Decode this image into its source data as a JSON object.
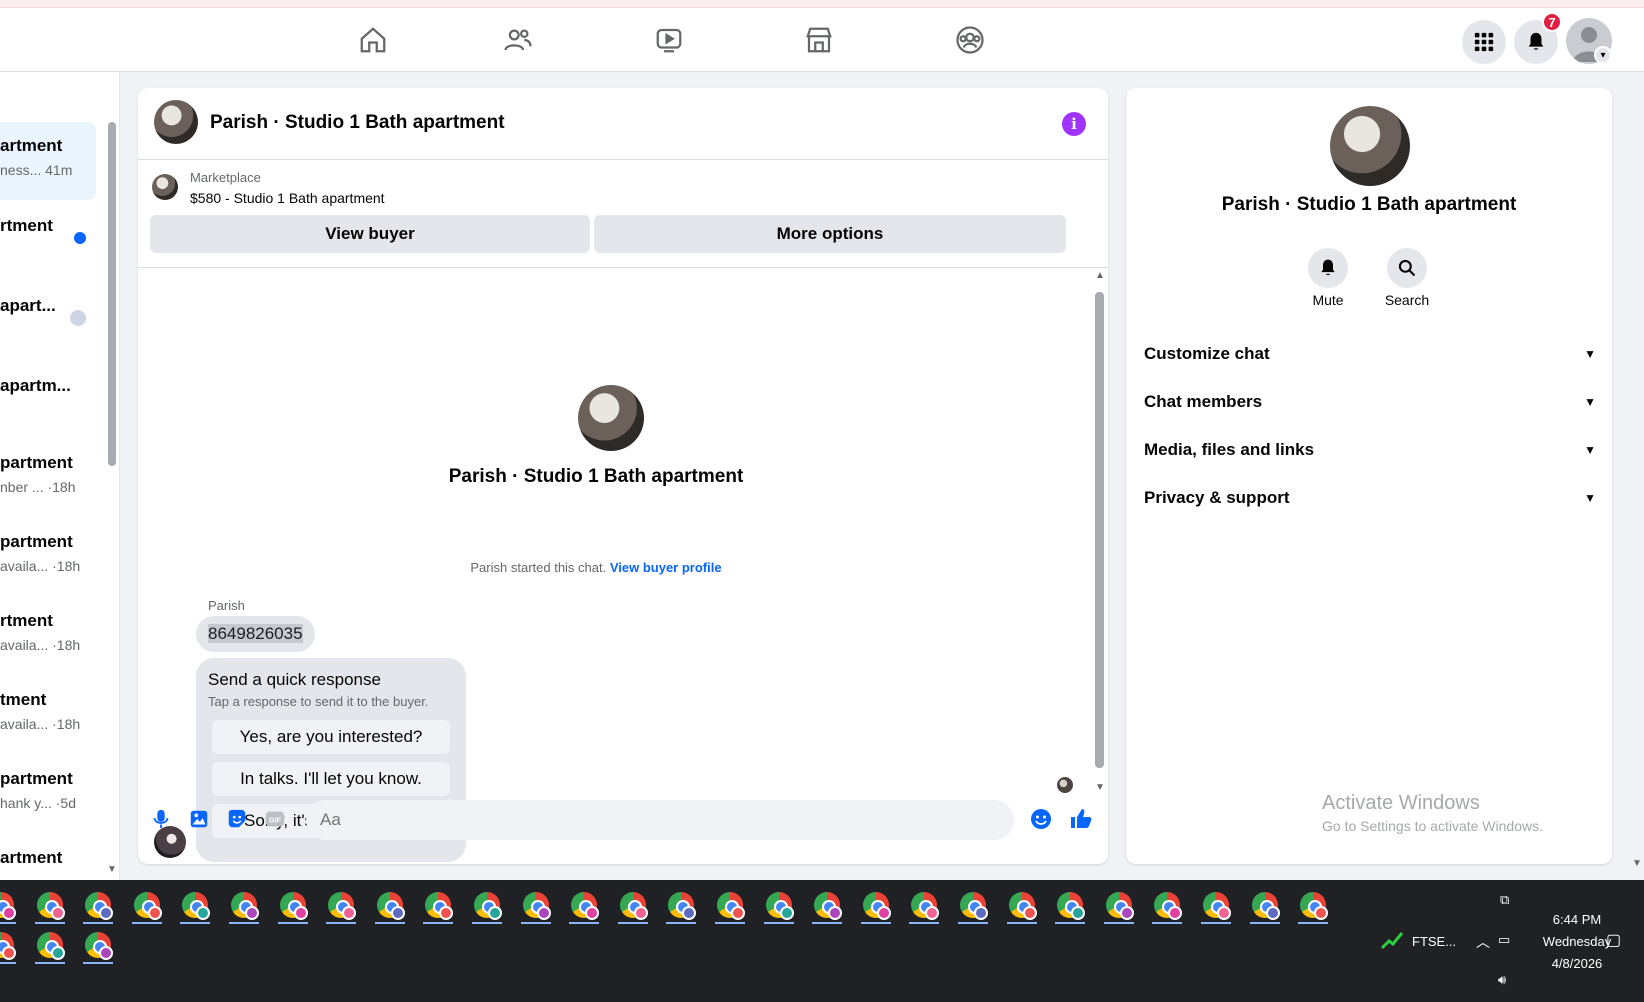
{
  "topbar": {
    "nav_icons": [
      "home-icon",
      "friends-icon",
      "watch-icon",
      "marketplace-icon",
      "groups-icon"
    ],
    "notification_count": "7"
  },
  "left_list": {
    "rows": [
      {
        "title": "artment",
        "snippet": "ness...  41m",
        "active": true
      },
      {
        "title": "rtment",
        "snippet": "",
        "unread": true
      },
      {
        "title": "apart...",
        "snippet": ""
      },
      {
        "title": "apartm...",
        "snippet": ""
      },
      {
        "title": "partment",
        "snippet": "nber ... ·18h"
      },
      {
        "title": "partment",
        "snippet": "availa... ·18h"
      },
      {
        "title": "rtment",
        "snippet": "availa... ·18h"
      },
      {
        "title": "tment",
        "snippet": "availa... ·18h"
      },
      {
        "title": "partment",
        "snippet": "hank y... ·5d"
      },
      {
        "title": "artment",
        "snippet": ""
      }
    ]
  },
  "chat": {
    "title": "Parish · Studio 1 Bath apartment",
    "marketplace_label": "Marketplace",
    "listing": "$580 - Studio 1 Bath apartment",
    "view_buyer": "View buyer",
    "more_options": "More options",
    "intro_title": "Parish · Studio 1 Bath apartment",
    "started_text": "Parish started this chat. ",
    "view_buyer_profile": "View buyer profile",
    "sender": "Parish",
    "message": "8649826035",
    "quick_title": "Send a quick response",
    "quick_sub": "Tap a response to send it to the buyer.",
    "quick_options": [
      "Yes, are you interested?",
      "In talks. I'll let you know.",
      "Sorry, it's not available."
    ],
    "composer_placeholder": "Aa"
  },
  "right_panel": {
    "name": "Parish · Studio 1 Bath apartment",
    "mute": "Mute",
    "search": "Search",
    "sections": [
      "Customize chat",
      "Chat members",
      "Media, files and links",
      "Privacy & support"
    ],
    "watermark_title": "Activate Windows",
    "watermark_sub": "Go to Settings to activate Windows."
  },
  "taskbar": {
    "ticker": "FTSE...",
    "time": "6:44 PM",
    "day": "Wednesday",
    "date": "4/8/2026"
  },
  "colors": {
    "accent": "#0866ff",
    "info": "#a033ff",
    "badge": "#e41e3f"
  }
}
